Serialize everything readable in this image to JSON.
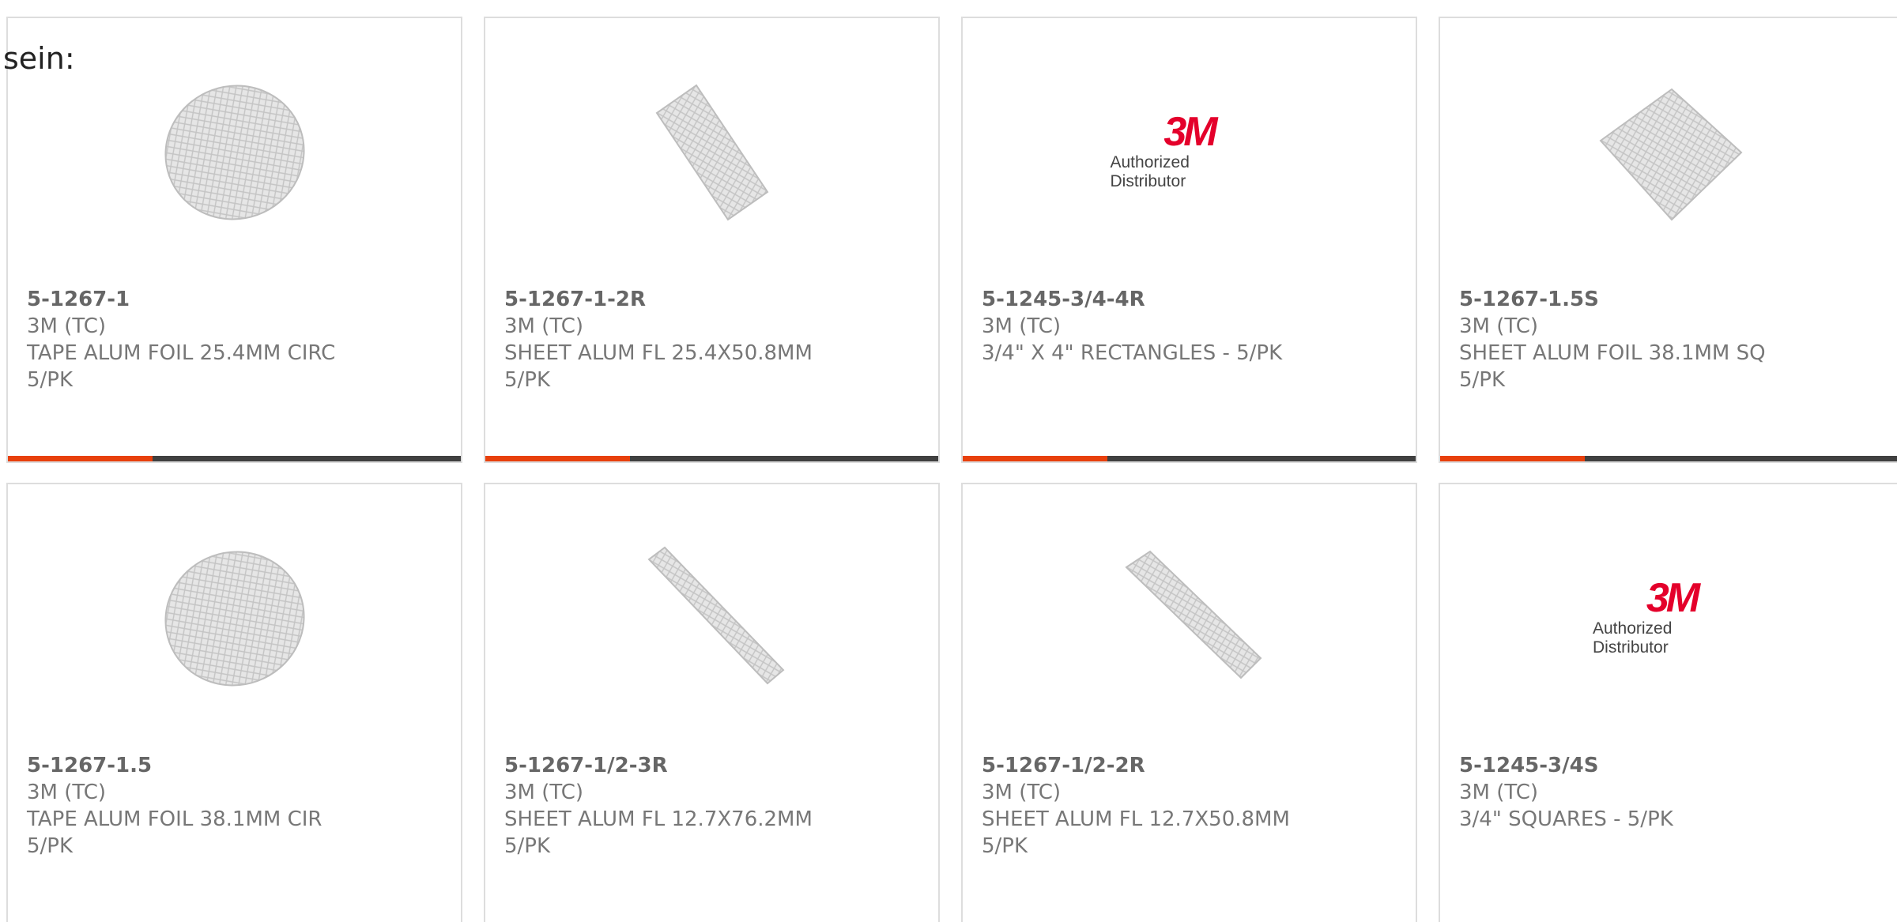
{
  "overlay_text": "sein:",
  "products": [
    {
      "part_number": "5-1267-1",
      "brand": "3M (TC)",
      "description": "TAPE ALUM FOIL 25.4MM CIRC",
      "pack": "5/PK",
      "image_type": "circle-foil-icon"
    },
    {
      "part_number": "5-1267-1-2R",
      "brand": "3M (TC)",
      "description": "SHEET ALUM FL 25.4X50.8MM",
      "pack": "5/PK",
      "image_type": "rectangle-foil-icon"
    },
    {
      "part_number": "5-1245-3/4-4R",
      "brand": "3M (TC)",
      "description": "3/4\" X 4\" RECTANGLES - 5/PK",
      "pack": "",
      "image_type": "3m-logo",
      "logo_mark": "3M",
      "logo_text": "Authorized Distributor"
    },
    {
      "part_number": "5-1267-1.5S",
      "brand": "3M (TC)",
      "description": "SHEET ALUM FOIL 38.1MM SQ",
      "pack": "5/PK",
      "image_type": "square-foil-icon"
    },
    {
      "part_number": "5-1267-1.5",
      "brand": "3M (TC)",
      "description": "TAPE ALUM FOIL 38.1MM CIR",
      "pack": "5/PK",
      "image_type": "circle-foil-icon"
    },
    {
      "part_number": "5-1267-1/2-3R",
      "brand": "3M (TC)",
      "description": "SHEET ALUM FL 12.7X76.2MM",
      "pack": "5/PK",
      "image_type": "strip-foil-icon"
    },
    {
      "part_number": "5-1267-1/2-2R",
      "brand": "3M (TC)",
      "description": "SHEET ALUM FL 12.7X50.8MM",
      "pack": "5/PK",
      "image_type": "strip-foil-icon"
    },
    {
      "part_number": "5-1245-3/4S",
      "brand": "3M (TC)",
      "description": "3/4\" SQUARES - 5/PK",
      "pack": "",
      "image_type": "3m-logo",
      "logo_mark": "3M",
      "logo_text": "Authorized Distributor"
    }
  ],
  "colors": {
    "accent": "#e8400c",
    "bar": "#404040",
    "card_border": "#dddddd",
    "text": "#777777",
    "logo_red": "#e4002b"
  }
}
